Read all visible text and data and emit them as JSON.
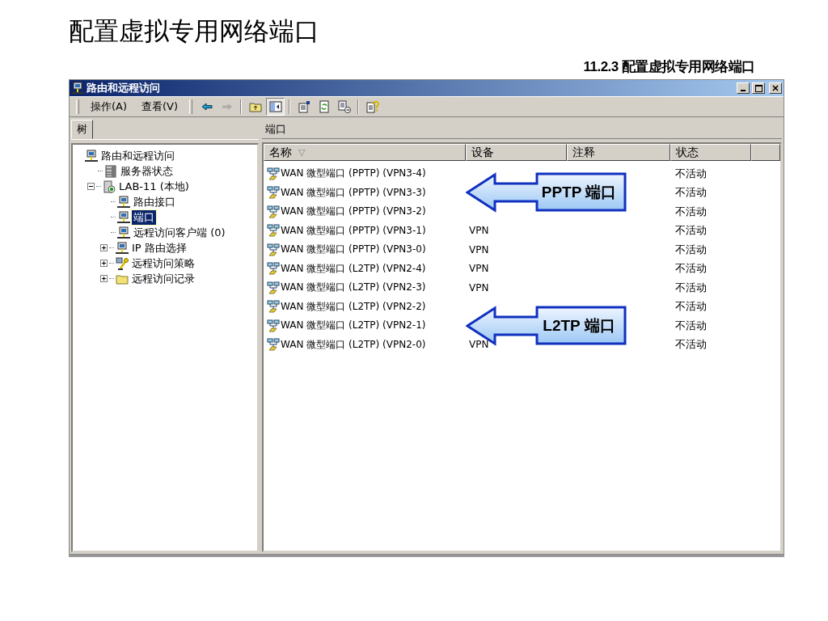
{
  "slide": {
    "title": "配置虚拟专用网络端口",
    "subtitle": "11.2.3 配置虚拟专用网络端口"
  },
  "window": {
    "title": "路由和远程访问"
  },
  "menu": [
    "操作(A)",
    "查看(V)"
  ],
  "toolbar": [
    {
      "kind": "back",
      "disabled": false,
      "pressed": false
    },
    {
      "kind": "forward",
      "disabled": true,
      "pressed": false
    },
    {
      "kind": "up",
      "disabled": false,
      "pressed": false
    },
    {
      "kind": "tree",
      "disabled": false,
      "pressed": true
    },
    {
      "kind": "properties",
      "disabled": false,
      "pressed": false
    },
    {
      "kind": "refresh",
      "disabled": false,
      "pressed": false
    },
    {
      "kind": "export",
      "disabled": false,
      "pressed": false
    },
    {
      "kind": "help",
      "disabled": false,
      "pressed": false
    }
  ],
  "tree": {
    "header": "树",
    "items": [
      {
        "label": "路由和远程访问",
        "kind": "computer",
        "selected": false,
        "children": [
          {
            "label": "服务器状态",
            "kind": "servers",
            "selected": false
          },
          {
            "label": "LAB-11 (本地)",
            "kind": "server",
            "selected": false,
            "expanded": true,
            "children": [
              {
                "label": "路由接口",
                "kind": "computer",
                "selected": false
              },
              {
                "label": "端口",
                "kind": "computer",
                "selected": true
              },
              {
                "label": "远程访问客户端 (0)",
                "kind": "computer",
                "selected": false
              },
              {
                "label": "IP 路由选择",
                "kind": "computer",
                "selected": false,
                "expanded": false
              },
              {
                "label": "远程访问策略",
                "kind": "policy",
                "selected": false,
                "expanded": false
              },
              {
                "label": "远程访问记录",
                "kind": "folder",
                "selected": false,
                "expanded": false
              }
            ]
          }
        ]
      }
    ]
  },
  "list": {
    "header": "端口",
    "columns": [
      {
        "label": "名称",
        "sort_indicator": "▽"
      },
      {
        "label": "设备"
      },
      {
        "label": "注释"
      },
      {
        "label": "状态"
      }
    ],
    "rows": [
      {
        "name": "WAN 微型端口 (PPTP) (VPN3-4)",
        "status": "不活动"
      },
      {
        "name": "WAN 微型端口 (PPTP) (VPN3-3)",
        "status": "不活动",
        "callout": "PPTP 端口"
      },
      {
        "name": "WAN 微型端口 (PPTP) (VPN3-2)",
        "status": "不活动"
      },
      {
        "name": "WAN 微型端口 (PPTP) (VPN3-1)",
        "device": "VPN",
        "status": "不活动"
      },
      {
        "name": "WAN 微型端口 (PPTP) (VPN3-0)",
        "device": "VPN",
        "status": "不活动"
      },
      {
        "name": "WAN 微型端口 (L2TP) (VPN2-4)",
        "device": "VPN",
        "status": "不活动"
      },
      {
        "name": "WAN 微型端口 (L2TP) (VPN2-3)",
        "device": "VPN",
        "status": "不活动"
      },
      {
        "name": "WAN 微型端口 (L2TP) (VPN2-2)",
        "status": "不活动"
      },
      {
        "name": "WAN 微型端口 (L2TP) (VPN2-1)",
        "status": "不活动",
        "callout": "L2TP 端口"
      },
      {
        "name": "WAN 微型端口 (L2TP) (VPN2-0)",
        "device": "VPN",
        "status": "不活动"
      }
    ]
  }
}
